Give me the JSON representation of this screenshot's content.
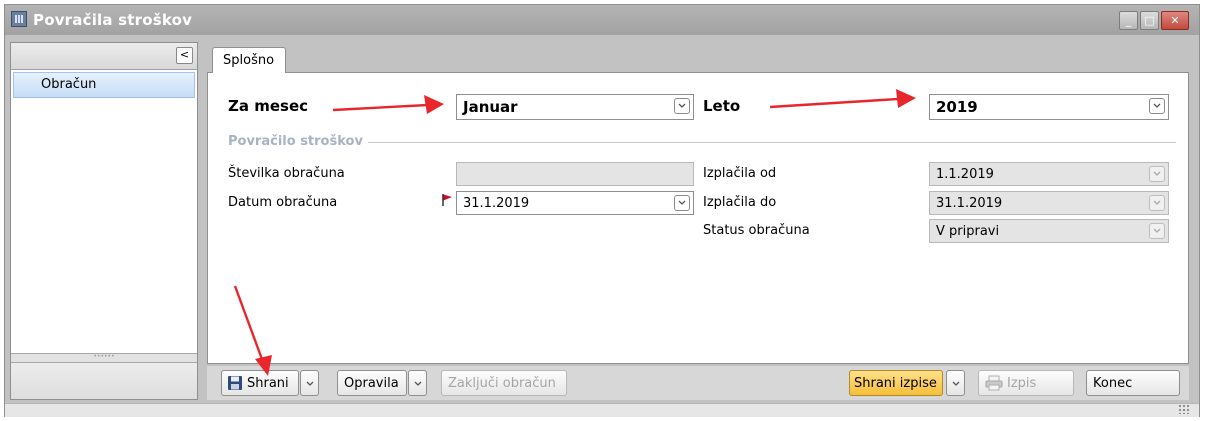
{
  "window": {
    "title": "Povračila stroškov",
    "minimize_glyph": "_",
    "maximize_glyph": "□",
    "close_glyph": "✕"
  },
  "left_panel": {
    "collapse_glyph": "<",
    "items": [
      {
        "label": "Obračun",
        "selected": true
      }
    ],
    "splitter_glyph": "••••••"
  },
  "tabs": [
    {
      "label": "Splošno",
      "active": true
    }
  ],
  "header_filters": {
    "month_label": "Za mesec",
    "month_value": "Januar",
    "year_label": "Leto",
    "year_value": "2019"
  },
  "group": {
    "title": "Povračilo stroškov",
    "left_fields": [
      {
        "label": "Številka obračuna",
        "value": "",
        "disabled": true
      },
      {
        "label": "Datum obračuna",
        "value": "31.1.2019",
        "disabled": false,
        "required_flag": true
      }
    ],
    "right_fields": [
      {
        "label": "Izplačila od",
        "value": "1.1.2019",
        "disabled": true
      },
      {
        "label": "Izplačila do",
        "value": "31.1.2019",
        "disabled": true
      },
      {
        "label": "Status obračuna",
        "value": "V pripravi",
        "disabled": true
      }
    ]
  },
  "toolbar": {
    "save_label": "Shrani",
    "tasks_label": "Opravila",
    "close_calc_label": "Zaključi obračun",
    "save_prints_label": "Shrani izpise",
    "print_label": "Izpis",
    "end_label": "Konec"
  },
  "colors": {
    "annotation_arrow": "#e8262b",
    "highlight_button": "#f6bf3a",
    "selected_item": "#c6ddf6",
    "group_title": "#a7b3c3"
  }
}
